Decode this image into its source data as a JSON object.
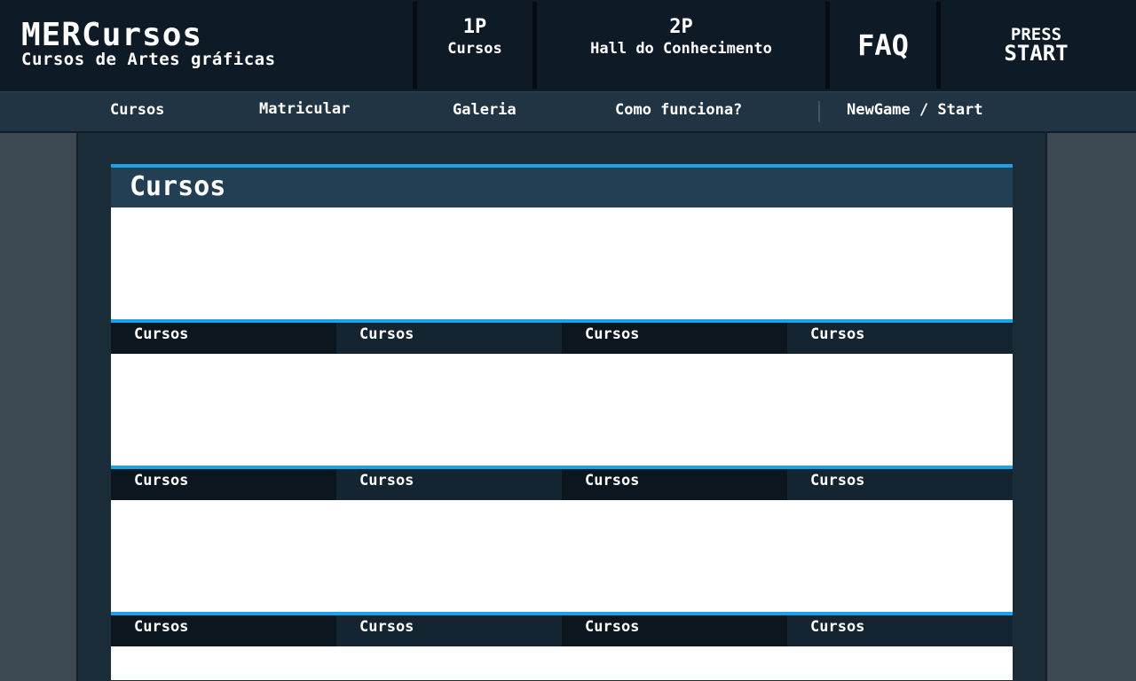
{
  "header": {
    "logo_title": "MERCursos",
    "logo_subtitle": "Cursos de Artes gráficas",
    "p1_top": "1P",
    "p1_bottom": "Cursos",
    "p2_top": "2P",
    "p2_bottom": "Hall do Conhecimento",
    "faq": "FAQ",
    "press": "PRESS",
    "start": "START"
  },
  "nav": {
    "cursos": "Cursos",
    "matricular": "Matricular",
    "galeria": "Galeria",
    "como_funciona": "Como funciona?",
    "newgame": "NewGame / Start"
  },
  "section": {
    "title": "Cursos",
    "rows": [
      {
        "tabs": [
          "Cursos",
          "Cursos",
          "Cursos",
          "Cursos"
        ]
      },
      {
        "tabs": [
          "Cursos",
          "Cursos",
          "Cursos",
          "Cursos"
        ]
      },
      {
        "tabs": [
          "Cursos",
          "Cursos",
          "Cursos",
          "Cursos"
        ]
      }
    ]
  },
  "colors": {
    "accent": "#1aa2ea",
    "header_bg": "#0e1a26",
    "nav_bg": "#213444",
    "section_head_bg": "#233f54",
    "page_bg": "#3c4852"
  }
}
